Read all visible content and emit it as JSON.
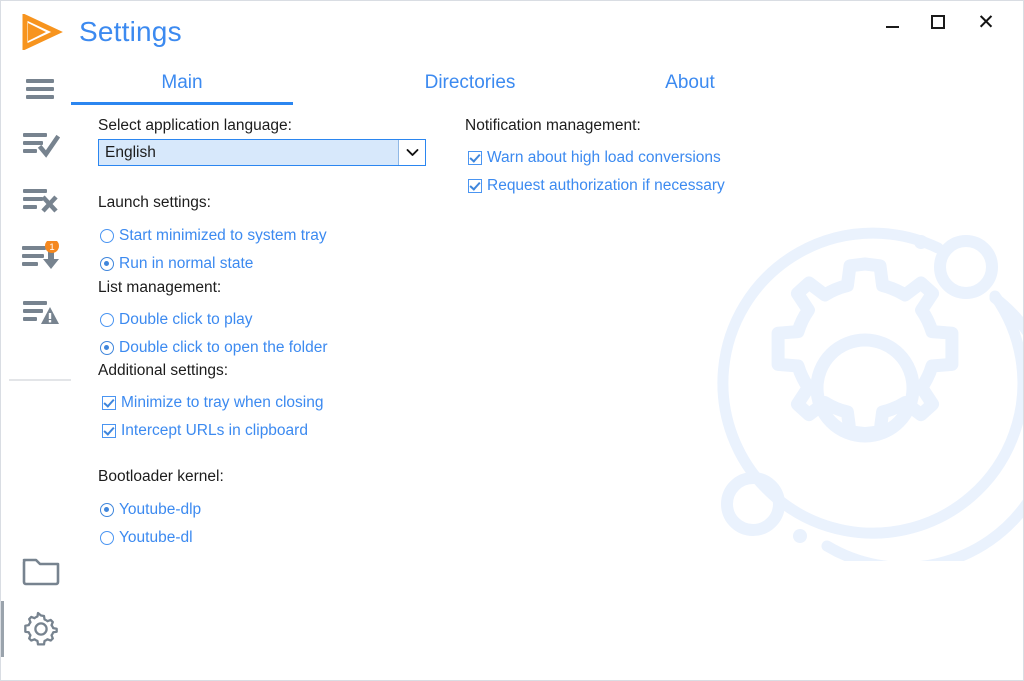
{
  "window": {
    "title": "Settings",
    "logo_icon": "orange-play-arrow-logo",
    "controls": [
      {
        "name": "minimize",
        "glyph": "–"
      },
      {
        "name": "maximize",
        "glyph": "□"
      },
      {
        "name": "close",
        "glyph": "✕"
      }
    ]
  },
  "colors": {
    "accent_blue": "#3c8af0",
    "tab_underline": "#2b86f0",
    "logo_orange": "#f7941e",
    "badge_orange": "#f5881f",
    "sidebar_icon_gray": "#77838f",
    "text_black": "#1c1c1c",
    "combo_fill": "#d7e8fb",
    "watermark_blue": "#eaf2fd"
  },
  "sidebar": {
    "items": [
      {
        "icon": "hamburger-menu-icon",
        "label": "All downloads",
        "badge": ""
      },
      {
        "icon": "list-check-icon",
        "label": "Completed",
        "badge": ""
      },
      {
        "icon": "list-x-icon",
        "label": "Failed",
        "badge": ""
      },
      {
        "icon": "list-download-arrow-icon",
        "label": "Downloading",
        "badge": "1"
      },
      {
        "icon": "list-warning-icon",
        "label": "Warnings",
        "badge": ""
      }
    ],
    "bottom_items": [
      {
        "icon": "folder-icon",
        "label": "Directories",
        "selected": false
      },
      {
        "icon": "gear-icon",
        "label": "Settings",
        "selected": true
      }
    ]
  },
  "tabs": [
    {
      "label": "Main",
      "active": true
    },
    {
      "label": "Directories",
      "active": false
    },
    {
      "label": "About",
      "active": false
    }
  ],
  "main": {
    "language": {
      "label": "Select application language:",
      "selected": "English",
      "arrow_icon": "chevron-down-icon"
    },
    "launch_settings": {
      "label": "Launch settings:",
      "options": [
        {
          "label": "Start minimized to system tray",
          "checked": false
        },
        {
          "label": "Run in normal state",
          "checked": true
        }
      ]
    },
    "list_management": {
      "label": "List management:",
      "options": [
        {
          "label": "Double click to play",
          "checked": false
        },
        {
          "label": "Double click to open the folder",
          "checked": true
        }
      ]
    },
    "additional_settings": {
      "label": "Additional settings:",
      "options": [
        {
          "label": "Minimize to tray when closing",
          "checked": true
        },
        {
          "label": "Intercept URLs in clipboard",
          "checked": true
        }
      ]
    },
    "bootloader_kernel": {
      "label": "Bootloader kernel:",
      "options": [
        {
          "label": "Youtube-dlp",
          "checked": true
        },
        {
          "label": "Youtube-dl",
          "checked": false
        }
      ]
    },
    "notification_management": {
      "label": "Notification management:",
      "options": [
        {
          "label": "Warn about high load conversions",
          "checked": true
        },
        {
          "label": "Request authorization if necessary",
          "checked": true
        }
      ]
    }
  },
  "watermark": {
    "icon": "gear-orbit-watermark"
  }
}
